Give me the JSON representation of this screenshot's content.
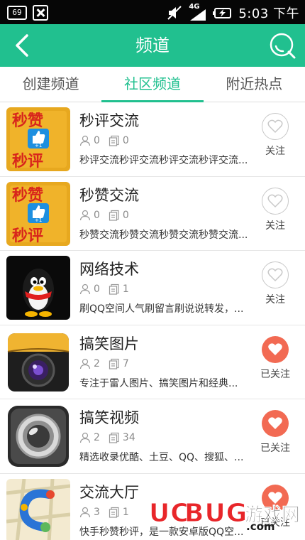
{
  "status_bar": {
    "badge": "69",
    "network": "4G",
    "time": "5:03 下午"
  },
  "header": {
    "title": "频道"
  },
  "tabs": [
    {
      "label": "创建频道",
      "active": false
    },
    {
      "label": "社区频道",
      "active": true
    },
    {
      "label": "附近热点",
      "active": false
    }
  ],
  "channels": [
    {
      "title": "秒评交流",
      "members": "0",
      "posts": "0",
      "desc": "秒评交流秒评交流秒评交流秒评交流...",
      "follow_label": "关注",
      "followed": false,
      "thumb": "miaozan-icon"
    },
    {
      "title": "秒赞交流",
      "members": "0",
      "posts": "0",
      "desc": "秒赞交流秒赞交流秒赞交流秒赞交流...",
      "follow_label": "关注",
      "followed": false,
      "thumb": "miaozan-icon"
    },
    {
      "title": "网络技术",
      "members": "0",
      "posts": "1",
      "desc": "刷QQ空间人气刷留言刷说说转发，...",
      "follow_label": "关注",
      "followed": false,
      "thumb": "qq-penguin-icon"
    },
    {
      "title": "搞笑图片",
      "members": "2",
      "posts": "7",
      "desc": "专注于雷人图片、搞笑图片和经典...",
      "follow_label": "已关注",
      "followed": true,
      "thumb": "camera-icon"
    },
    {
      "title": "搞笑视频",
      "members": "2",
      "posts": "34",
      "desc": "精选收录优酷、土豆、QQ、搜狐、...",
      "follow_label": "已关注",
      "followed": true,
      "thumb": "video-lens-icon"
    },
    {
      "title": "交流大厅",
      "members": "3",
      "posts": "1",
      "desc": "快手秒赞秒评，是一款安卓版QQ空...",
      "follow_label": "已关注",
      "followed": true,
      "thumb": "map-icon"
    }
  ],
  "watermark": {
    "brand_a": "UC",
    "brand_b": "BUG",
    "brand_cn": "游戏网",
    "domain": ".com"
  },
  "colors": {
    "accent": "#21c08f",
    "follow_on": "#f26a53",
    "status_bar": "#060606"
  }
}
